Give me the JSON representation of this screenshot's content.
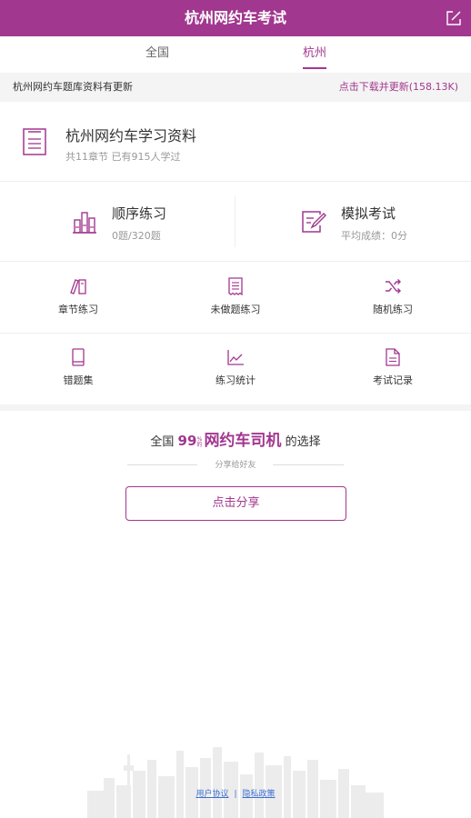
{
  "header": {
    "title": "杭州网约车考试",
    "edit_icon": "edit-icon"
  },
  "tabs": [
    {
      "label": "全国",
      "active": false
    },
    {
      "label": "杭州",
      "active": true
    }
  ],
  "notice": {
    "text": "杭州网约车题库资料有更新",
    "action": "点击下载并更新(158.13K)"
  },
  "study": {
    "title": "杭州网约车学习资料",
    "subtitle": "共11章节 已有915人学过",
    "icon": "document-icon"
  },
  "practice": {
    "sequential": {
      "title": "顺序练习",
      "subtitle": "0题/320题",
      "icon": "bars-icon"
    },
    "mock_exam": {
      "title": "模拟考试",
      "subtitle": "平均成绩：0分",
      "icon": "exam-edit-icon"
    }
  },
  "grid": [
    {
      "label": "章节练习",
      "icon": "book-pen-icon"
    },
    {
      "label": "未做题练习",
      "icon": "receipt-icon"
    },
    {
      "label": "随机练习",
      "icon": "shuffle-icon"
    },
    {
      "label": "错题集",
      "icon": "notebook-icon"
    },
    {
      "label": "练习统计",
      "icon": "chart-line-icon"
    },
    {
      "label": "考试记录",
      "icon": "file-icon"
    }
  ],
  "share": {
    "slogan_prefix": "全国",
    "slogan_number": "99",
    "slogan_percent_top": "%",
    "slogan_percent_bottom": "的",
    "slogan_brand": "网约车司机",
    "slogan_suffix": "的选择",
    "caption": "分享给好友",
    "button_label": "点击分享"
  },
  "footer": {
    "user_agreement": "用户协议",
    "separator": "|",
    "privacy_policy": "隐私政策"
  },
  "colors": {
    "accent": "#a2378f",
    "link": "#3c6fd0",
    "divider": "#eeeeee",
    "band": "#f4f4f4"
  }
}
